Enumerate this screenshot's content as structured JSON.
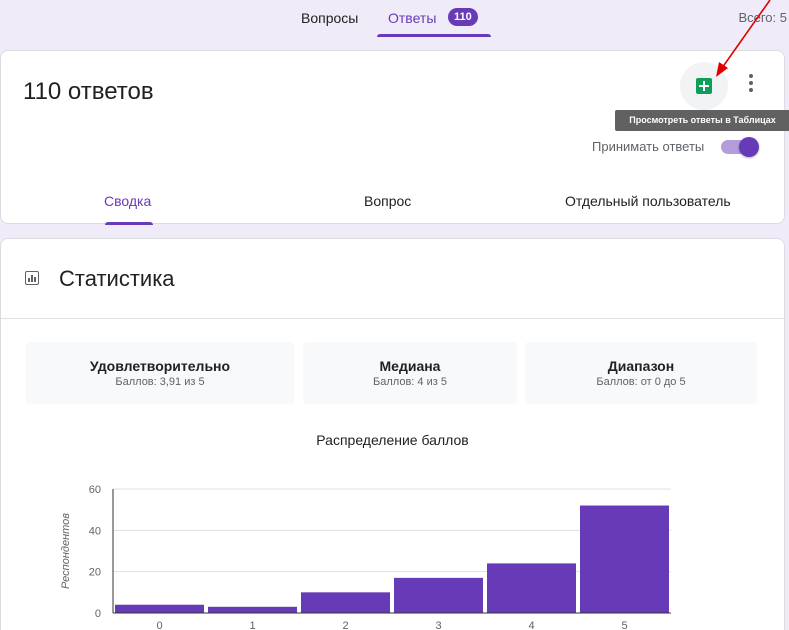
{
  "topnav": {
    "questions_label": "Вопросы",
    "answers_label": "Ответы",
    "answers_count": "110",
    "total_label": "Всего: 5"
  },
  "responses_card": {
    "count_title": "110 ответов",
    "sheets_icon": "google-sheets-icon",
    "tooltip": "Просмотреть ответы в Таблицах",
    "accept_label": "Принимать ответы",
    "accept_on": true,
    "tabs": [
      {
        "label": "Сводка",
        "active": true
      },
      {
        "label": "Вопрос",
        "active": false
      },
      {
        "label": "Отдельный пользователь",
        "active": false
      }
    ]
  },
  "stats_card": {
    "title": "Статистика",
    "boxes": [
      {
        "title": "Удовлетворительно",
        "value": "Баллов: 3,91 из 5"
      },
      {
        "title": "Медиана",
        "value": "Баллов: 4 из 5"
      },
      {
        "title": "Диапазон",
        "value": "Баллов: от 0 до 5"
      }
    ]
  },
  "colors": {
    "accent": "#673ab7",
    "bar": "#673ab7",
    "sheets": "#0f9d58",
    "annotation_arrow": "#e00000"
  },
  "chart_data": {
    "type": "bar",
    "title": "Распределение баллов",
    "ylabel": "Респондентов",
    "xlabel": "",
    "categories": [
      "0",
      "1",
      "2",
      "3",
      "4",
      "5"
    ],
    "values": [
      4,
      3,
      10,
      17,
      24,
      52
    ],
    "ylim": [
      0,
      60
    ],
    "yticks": [
      0,
      20,
      40,
      60
    ],
    "grid": true
  }
}
